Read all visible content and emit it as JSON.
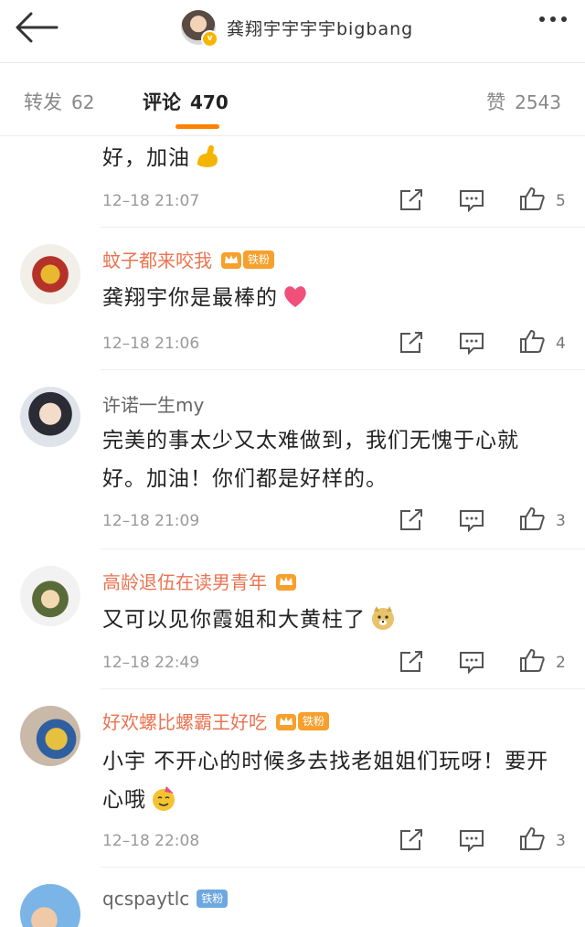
{
  "header": {
    "title": "龚翔宇宇宇宇bigbang",
    "back_icon": "back-arrow-icon",
    "more_icon": "more-icon"
  },
  "tabs": {
    "repost_label": "转发",
    "repost_count": "62",
    "comment_label": "评论",
    "comment_count": "470",
    "like_label": "赞",
    "like_count": "2543",
    "accent": "#ff8200"
  },
  "comments": [
    {
      "text": "好，加油",
      "time": "12–18 21:07",
      "likes": "5"
    },
    {
      "name": "蚊子都来咬我",
      "fan": "铁粉",
      "text": "龚翔宇你是最棒的",
      "time": "12–18 21:06",
      "likes": "4"
    },
    {
      "name": "许诺一生my",
      "text": "完美的事太少又太难做到，我们无愧于心就好。加油！你们都是好样的。",
      "time": "12–18 21:09",
      "likes": "3"
    },
    {
      "name": "高龄退伍在读男青年",
      "text": "又可以见你霞姐和大黄柱了",
      "time": "12–18 22:49",
      "likes": "2"
    },
    {
      "name": "好欢螺比螺霸王好吃",
      "fan": "铁粉",
      "text": "小宇 不开心的时候多去找老姐姐们玩呀！要开心哦",
      "time": "12–18 22:08",
      "likes": "3"
    },
    {
      "name": "qcspaytlc",
      "fan": "铁粉"
    }
  ],
  "colors": {
    "name_orange": "#eb7350",
    "fan_orange": "#f7a02c",
    "fan_blue": "#6ea8e0"
  }
}
